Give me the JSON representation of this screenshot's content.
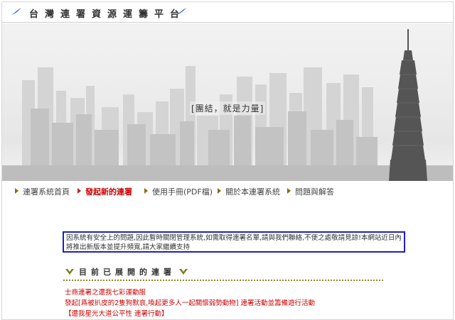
{
  "header": {
    "site_title": "台灣連署資源運籌平台"
  },
  "banner": {
    "slogan": "[團結，就是力量]"
  },
  "nav": {
    "items": [
      {
        "label": "連署系統首頁",
        "active": false
      },
      {
        "label": "發起新的連署",
        "active": true
      },
      {
        "label": "使用手冊(PDF檔)",
        "active": false
      },
      {
        "label": "關於本連署系統",
        "active": false
      },
      {
        "label": "問題與解答",
        "active": false
      }
    ]
  },
  "notice": {
    "text": "因系統有安全上的問題,因此暫時關閉管理系統,如需取得連署名單,請與我們聯絡,不便之處敬請見諒!本網站近日內將推出新版本並提升頻寬,請大家繼續支持"
  },
  "section": {
    "title": "目前已展開的連署"
  },
  "petitions": [
    "士商連署之還我七彩運動服",
    "發起[爲被扒皮的2隻狗默哀,喚起更多人一起關懷弱勢動物] 連署活動並籌備遊行活動",
    "【還我星光大道公平性 連署行動】"
  ],
  "colors": {
    "accent_blue": "#1f1fbf",
    "link_red": "#cc0000",
    "nav_arrow": "#8a6a1a",
    "flourish_olive": "#7a7a1a"
  }
}
